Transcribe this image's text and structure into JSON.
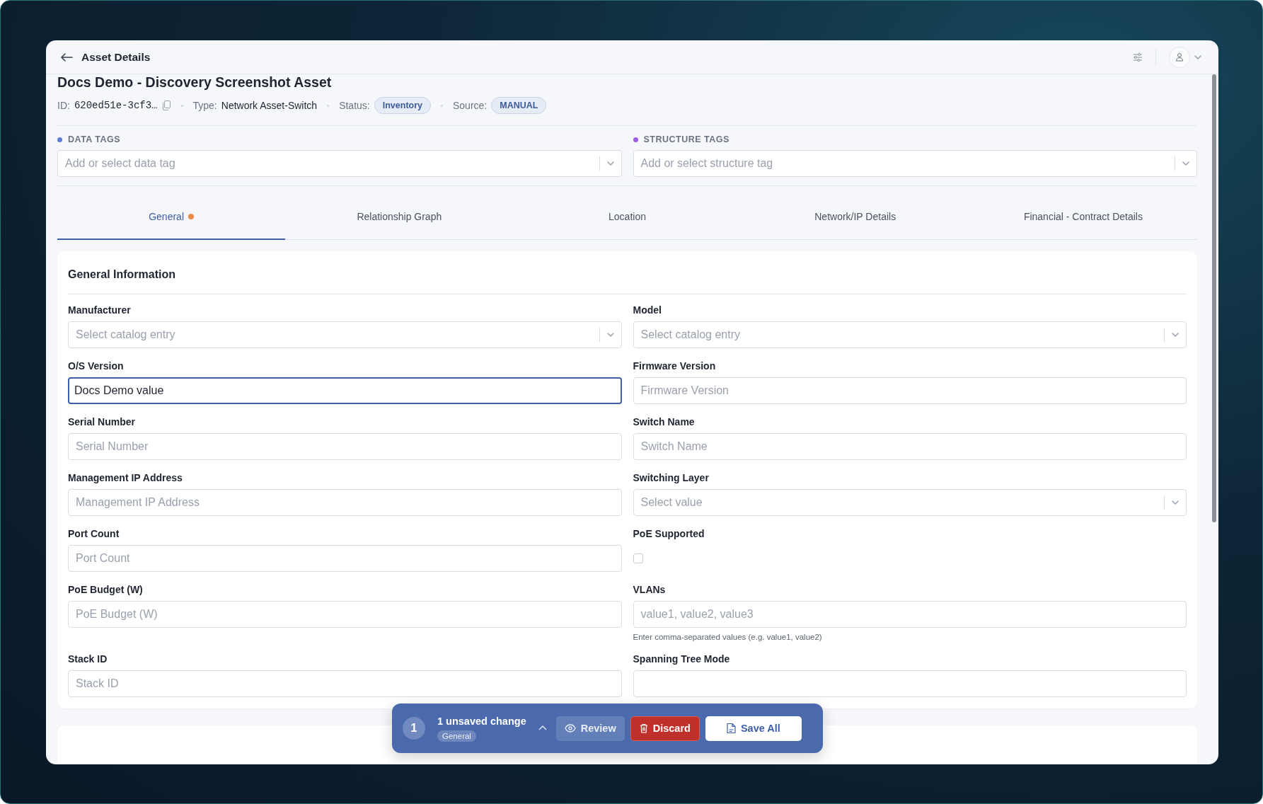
{
  "header": {
    "title": "Asset Details"
  },
  "asset": {
    "name": "Docs Demo - Discovery Screenshot Asset",
    "meta": [
      {
        "kind": "code",
        "label": "ID:",
        "value": "620ed51e-3cf3…"
      },
      {
        "kind": "text",
        "label": "Type:",
        "value": "Network Asset-Switch"
      },
      {
        "kind": "badge",
        "label": "Status:",
        "value": "Inventory"
      },
      {
        "kind": "badge",
        "label": "Source:",
        "value": "MANUAL"
      }
    ]
  },
  "tag_fields": [
    {
      "label": "DATA TAGS",
      "color": "#5b7fd6",
      "placeholder": "Add or select data tag"
    },
    {
      "label": "STRUCTURE TAGS",
      "color": "#9d5ce6",
      "placeholder": "Add or select structure tag"
    }
  ],
  "tabs": [
    {
      "label": "General",
      "selected": true,
      "modified": true
    },
    {
      "label": "Relationship Graph",
      "selected": false,
      "modified": false
    },
    {
      "label": "Location",
      "selected": false,
      "modified": false
    },
    {
      "label": "Network/IP Details",
      "selected": false,
      "modified": false
    },
    {
      "label": "Financial - Contract Details",
      "selected": false,
      "modified": false
    }
  ],
  "section": {
    "title": "General Information",
    "fields": [
      {
        "kind": "select",
        "label": "Manufacturer",
        "placeholder": "Select catalog entry",
        "focused": false
      },
      {
        "kind": "select",
        "label": "Model",
        "placeholder": "Select catalog entry",
        "focused": false
      },
      {
        "kind": "text",
        "label": "O/S Version",
        "value": "Docs Demo value",
        "focused": true
      },
      {
        "kind": "text",
        "label": "Firmware Version",
        "placeholder": "Firmware Version",
        "focused": false
      },
      {
        "kind": "text",
        "label": "Serial Number",
        "placeholder": "Serial Number",
        "focused": false
      },
      {
        "kind": "text",
        "label": "Switch Name",
        "placeholder": "Switch Name",
        "focused": false
      },
      {
        "kind": "text",
        "label": "Management IP Address",
        "placeholder": "Management IP Address",
        "focused": false
      },
      {
        "kind": "select",
        "label": "Switching Layer",
        "placeholder": "Select value",
        "focused": false
      },
      {
        "kind": "text",
        "label": "Port Count",
        "placeholder": "Port Count",
        "focused": false
      },
      {
        "kind": "checkbox",
        "label": "PoE Supported",
        "checked": false
      },
      {
        "kind": "text",
        "label": "PoE Budget (W)",
        "placeholder": "PoE Budget (W)",
        "focused": false
      },
      {
        "kind": "text",
        "label": "VLANs",
        "placeholder": "value1, value2, value3",
        "help": "Enter comma-separated values (e.g. value1, value2)",
        "focused": false
      },
      {
        "kind": "text",
        "label": "Stack ID",
        "placeholder": "Stack ID",
        "focused": false
      },
      {
        "kind": "text",
        "label": "Spanning Tree Mode",
        "focused": false
      }
    ]
  },
  "unsaved_bar": {
    "count": "1",
    "message": "1 unsaved change",
    "chip": "General",
    "buttons": [
      {
        "kind": "review",
        "label": "Review"
      },
      {
        "kind": "discard",
        "label": "Discard"
      },
      {
        "kind": "save",
        "label": "Save All"
      }
    ]
  }
}
